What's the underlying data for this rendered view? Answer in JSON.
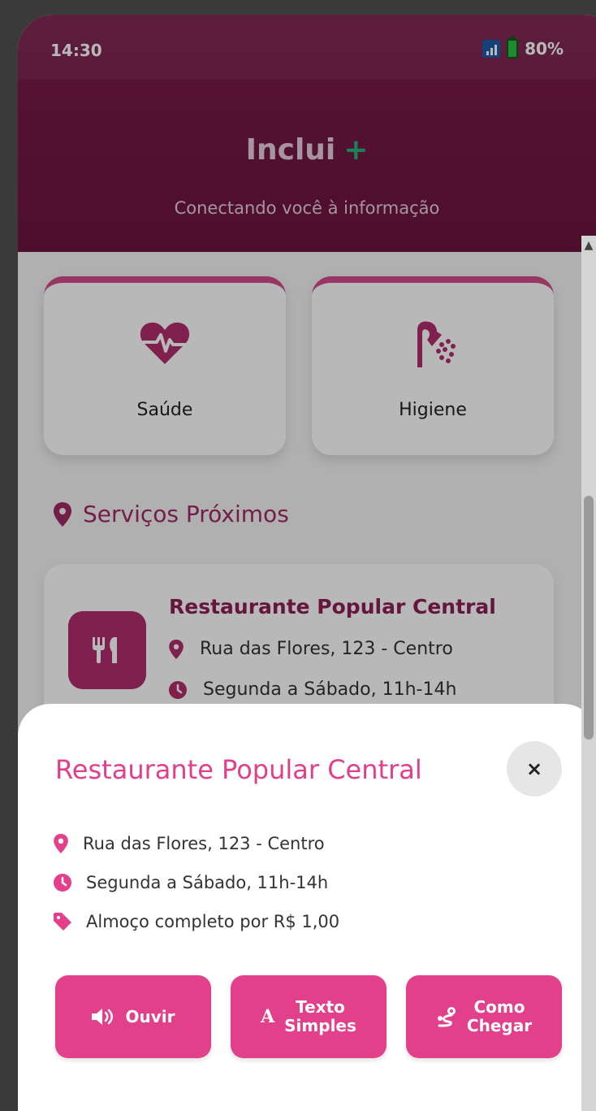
{
  "status_bar": {
    "time": "14:30",
    "battery": "80%"
  },
  "header": {
    "title": "Inclui",
    "plus": "+",
    "tagline": "Conectando você à informação"
  },
  "categories": [
    {
      "label": "Saúde",
      "icon": "heartbeat-icon"
    },
    {
      "label": "Higiene",
      "icon": "shower-icon"
    }
  ],
  "section": {
    "title": "Serviços Próximos",
    "icon": "map-pin-icon"
  },
  "service": {
    "name": "Restaurante Popular Central",
    "address": "Rua das Flores, 123 - Centro",
    "hours": "Segunda a Sábado, 11h-14h",
    "icon": "utensils-icon"
  },
  "sheet": {
    "title": "Restaurante Popular Central",
    "close": "×",
    "address": "Rua das Flores, 123 - Centro",
    "hours": "Segunda a Sábado, 11h-14h",
    "price": "Almoço completo por R$ 1,00",
    "buttons": {
      "listen": "Ouvir",
      "simple_text_line1": "Texto",
      "simple_text_line2": "Simples",
      "simple_text_glyph": "A",
      "directions_line1": "Como",
      "directions_line2": "Chegar"
    }
  },
  "colors": {
    "primary": "#e2408b",
    "header": "#7b1d4c",
    "accent": "#24b37a"
  }
}
